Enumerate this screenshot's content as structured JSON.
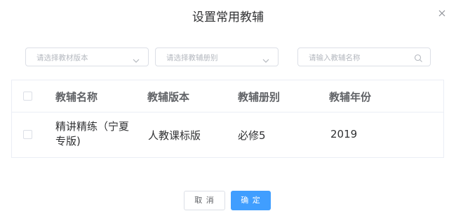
{
  "dialog": {
    "title": "设置常用教辅",
    "close_icon": "close-icon"
  },
  "filters": {
    "version_select_placeholder": "请选择教材版本",
    "volume_select_placeholder": "请选择教辅册别",
    "search_placeholder": "请输入教辅名称"
  },
  "table": {
    "columns": [
      "教辅名称",
      "教辅版本",
      "教辅册别",
      "教辅年份"
    ],
    "rows": [
      {
        "name": "精讲精练（宁夏专版)",
        "version": "人教课标版",
        "volume": "必修5",
        "year": "2019",
        "checked": false
      }
    ]
  },
  "footer": {
    "cancel_label": "取 消",
    "confirm_label": "确 定"
  },
  "colors": {
    "primary": "#409eff",
    "border": "#dcdfe6",
    "placeholder": "#b4b8bf"
  }
}
